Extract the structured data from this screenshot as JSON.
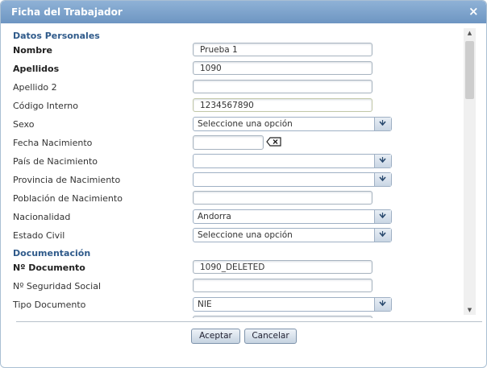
{
  "dialog": {
    "title": "Ficha del Trabajador",
    "close_label": "×"
  },
  "sections": {
    "personal": "Datos Personales",
    "documents": "Documentación"
  },
  "fields": {
    "nombre": {
      "label": "Nombre",
      "value": "Prueba 1"
    },
    "apellidos": {
      "label": "Apellidos",
      "value": "1090"
    },
    "apellido2": {
      "label": "Apellido 2",
      "value": ""
    },
    "codigo": {
      "label": "Código Interno",
      "value": "1234567890"
    },
    "sexo": {
      "label": "Sexo",
      "value": "Seleccione una opción"
    },
    "fecha": {
      "label": "Fecha Nacimiento",
      "value": ""
    },
    "pais": {
      "label": "País de Nacimiento",
      "value": ""
    },
    "provincia": {
      "label": "Provincia de Nacimiento",
      "value": ""
    },
    "poblacion": {
      "label": "Población de Nacimiento",
      "value": ""
    },
    "nacionalidad": {
      "label": "Nacionalidad",
      "value": "Andorra"
    },
    "estado_civil": {
      "label": "Estado Civil",
      "value": "Seleccione una opción"
    },
    "documento": {
      "label": "Nº Documento",
      "value": "1090_DELETED"
    },
    "seguridad": {
      "label": "Nº Seguridad Social",
      "value": ""
    },
    "tipo_documento": {
      "label": "Tipo Documento",
      "value": "NIE"
    }
  },
  "buttons": {
    "accept": "Aceptar",
    "cancel": "Cancelar"
  },
  "icons": {
    "close": "close-icon",
    "clear": "clear-date-icon",
    "dropdown": "chevron-down-icon"
  },
  "colors": {
    "title_bar": "#7ba2cc",
    "section": "#2f5a8a"
  }
}
